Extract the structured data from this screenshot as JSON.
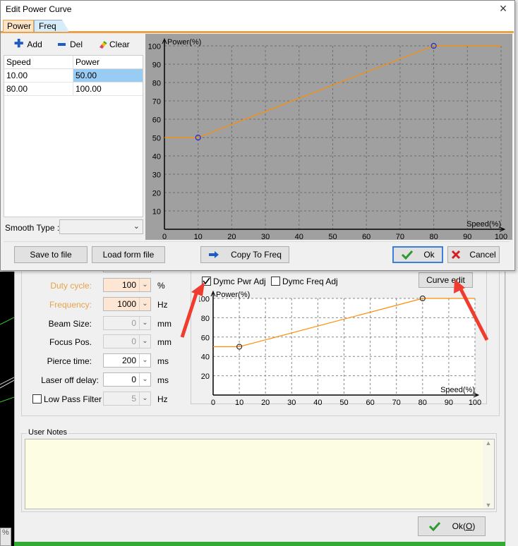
{
  "dialog": {
    "title": "Edit Power Curve",
    "tabs": [
      "Power",
      "Freq"
    ],
    "toolbar": {
      "add": "Add",
      "del": "Del",
      "clear": "Clear"
    },
    "table": {
      "headers": [
        "Speed",
        "Power"
      ],
      "rows": [
        [
          "10.00",
          "50.00"
        ],
        [
          "80.00",
          "100.00"
        ]
      ]
    },
    "smooth_type_label": "Smooth Type :",
    "buttons": {
      "save": "Save to file",
      "load": "Load form file",
      "copy": "Copy To Freq",
      "ok": "Ok",
      "cancel": "Cancel"
    }
  },
  "chart_data": [
    {
      "type": "line",
      "ylabel": "Power(%)",
      "xlabel": "Speed(%)",
      "xlim": [
        0,
        100
      ],
      "ylim": [
        0,
        100
      ],
      "xticks": [
        0,
        10,
        20,
        30,
        40,
        50,
        60,
        70,
        80,
        90,
        100
      ],
      "yticks": [
        10,
        20,
        30,
        40,
        50,
        60,
        70,
        80,
        90,
        100
      ],
      "grid": true,
      "x": [
        0,
        10,
        80,
        100
      ],
      "y": [
        50,
        50,
        100,
        100
      ],
      "control_points": [
        [
          10,
          50
        ],
        [
          80,
          100
        ]
      ],
      "line_color": "#ff8c00",
      "background": "#a0a0a0"
    },
    {
      "type": "line",
      "ylabel": "Power(%)",
      "xlabel": "Speed(%)",
      "xlim": [
        0,
        100
      ],
      "ylim": [
        0,
        100
      ],
      "xticks": [
        0,
        10,
        20,
        30,
        40,
        50,
        60,
        70,
        80,
        90,
        100
      ],
      "yticks": [
        20,
        40,
        60,
        80,
        100
      ],
      "grid": true,
      "x": [
        0,
        10,
        80,
        100
      ],
      "y": [
        50,
        50,
        100,
        100
      ],
      "control_points": [
        [
          10,
          50
        ],
        [
          80,
          100
        ]
      ],
      "line_color": "#ff8c00",
      "background": "#ffffff"
    }
  ],
  "params": {
    "duty": {
      "label": "Duty cycle:",
      "value": "100",
      "unit": "%"
    },
    "freq": {
      "label": "Frequency:",
      "value": "1000",
      "unit": "Hz"
    },
    "beam": {
      "label": "Beam Size:",
      "value": "0",
      "unit": "mm"
    },
    "focus": {
      "label": "Focus Pos.",
      "value": "0",
      "unit": "mm"
    },
    "pierce": {
      "label": "Pierce time:",
      "value": "200",
      "unit": "ms"
    },
    "laseroff": {
      "label": "Laser off delay:",
      "value": "0",
      "unit": "ms"
    },
    "lowpass": {
      "label": "Low Pass Filter",
      "value": "5",
      "unit": "Hz"
    }
  },
  "dymc_pwr": "Dymc Pwr Adj",
  "dymc_freq": "Dymc Freq Adj",
  "curve_edit": "Curve edit",
  "user_notes": "User Notes",
  "bottom_ok": {
    "pre": "Ok(",
    "key": "O",
    "post": ")"
  },
  "colors": {
    "accent_orange": "#e9a24a",
    "ok_green": "#2e9a2e",
    "cancel_red": "#d42020",
    "annotation_red": "#f03c2e"
  }
}
